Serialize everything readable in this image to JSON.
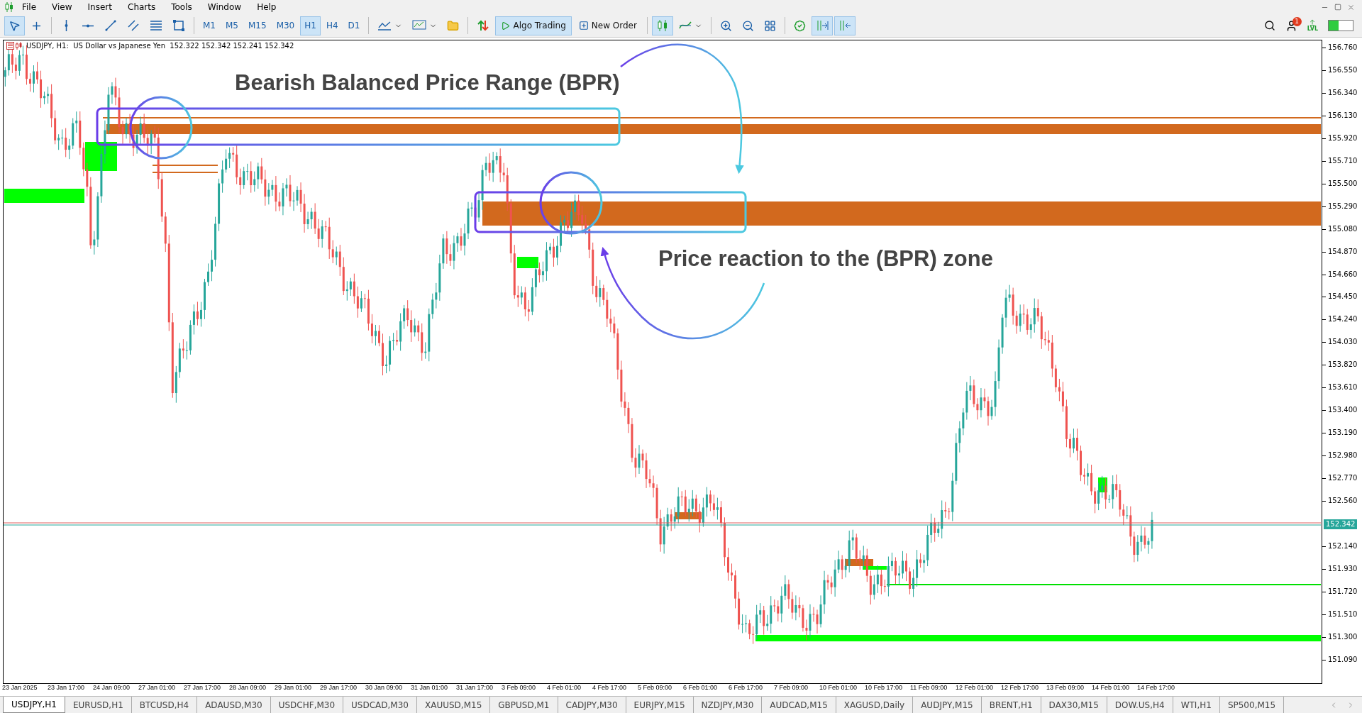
{
  "menu": [
    "File",
    "View",
    "Insert",
    "Charts",
    "Tools",
    "Window",
    "Help"
  ],
  "toolbar": {
    "tools": [
      {
        "kind": "cursor",
        "selected": true
      },
      {
        "kind": "crosshair",
        "selected": false
      },
      {
        "kind": "vline",
        "selected": false
      },
      {
        "kind": "hline",
        "selected": false
      },
      {
        "kind": "trend",
        "selected": false
      },
      {
        "kind": "channel",
        "selected": false
      },
      {
        "kind": "fibo",
        "selected": false
      },
      {
        "kind": "shapes",
        "selected": false
      }
    ],
    "timeframes": [
      {
        "label": "M1",
        "selected": false
      },
      {
        "label": "M5",
        "selected": false
      },
      {
        "label": "M15",
        "selected": false
      },
      {
        "label": "M30",
        "selected": false
      },
      {
        "label": "H1",
        "selected": true
      },
      {
        "label": "H4",
        "selected": false
      },
      {
        "label": "D1",
        "selected": false
      }
    ],
    "algo_trading": {
      "label": "Algo Trading",
      "selected": true
    },
    "new_order": {
      "label": "New Order"
    },
    "chart_tools": [
      {
        "kind": "candles",
        "selected": true
      },
      {
        "kind": "indicators",
        "selected": false
      },
      {
        "kind": "zoom_in",
        "selected": false
      },
      {
        "kind": "zoom_out",
        "selected": false
      },
      {
        "kind": "grid",
        "selected": false
      },
      {
        "kind": "verified",
        "selected": false
      },
      {
        "kind": "shift_end",
        "selected": true
      },
      {
        "kind": "autoscroll",
        "selected": true
      }
    ],
    "notifications_badge": "1",
    "level_label": "LVL"
  },
  "chart": {
    "info": "USDJPY, H1:  US Dollar vs Japanese Yen  152.322 152.342 152.241 152.342",
    "annotations": [
      "Bearish Balanced Price Range (BPR)",
      "Price reaction to the (BPR) zone"
    ],
    "price_labels": [
      "156.760",
      "156.550",
      "156.340",
      "156.130",
      "155.920",
      "155.710",
      "155.500",
      "155.290",
      "155.080",
      "154.870",
      "154.660",
      "154.450",
      "154.240",
      "154.030",
      "153.820",
      "153.610",
      "153.400",
      "153.190",
      "152.980",
      "152.770",
      "152.560",
      "152.140",
      "151.930",
      "151.720",
      "151.510",
      "151.300",
      "151.090"
    ],
    "current_price": "152.342",
    "time_labels": [
      "23 Jan 2025",
      "23 Jan 17:00",
      "24 Jan 09:00",
      "27 Jan 01:00",
      "27 Jan 17:00",
      "28 Jan 09:00",
      "29 Jan 01:00",
      "29 Jan 17:00",
      "30 Jan 09:00",
      "31 Jan 01:00",
      "31 Jan 17:00",
      "3 Feb 09:00",
      "4 Feb 01:00",
      "4 Feb 17:00",
      "5 Feb 09:00",
      "6 Feb 01:00",
      "6 Feb 17:00",
      "7 Feb 09:00",
      "10 Feb 01:00",
      "10 Feb 17:00",
      "11 Feb 09:00",
      "12 Feb 01:00",
      "12 Feb 17:00",
      "13 Feb 09:00",
      "14 Feb 01:00",
      "14 Feb 17:00"
    ]
  },
  "tabs": [
    {
      "label": "USDJPY,H1",
      "selected": true
    },
    {
      "label": "EURUSD,H1",
      "selected": false
    },
    {
      "label": "BTCUSD,H4",
      "selected": false
    },
    {
      "label": "ADAUSD,M30",
      "selected": false
    },
    {
      "label": "USDCHF,M30",
      "selected": false
    },
    {
      "label": "USDCAD,M30",
      "selected": false
    },
    {
      "label": "XAUUSD,M15",
      "selected": false
    },
    {
      "label": "GBPUSD,M1",
      "selected": false
    },
    {
      "label": "CADJPY,M30",
      "selected": false
    },
    {
      "label": "EURJPY,M15",
      "selected": false
    },
    {
      "label": "NZDJPY,M30",
      "selected": false
    },
    {
      "label": "AUDCAD,M15",
      "selected": false
    },
    {
      "label": "XAGUSD,Daily",
      "selected": false
    },
    {
      "label": "AUDJPY,M15",
      "selected": false
    },
    {
      "label": "BRENT,H1",
      "selected": false
    },
    {
      "label": "DAX30,M15",
      "selected": false
    },
    {
      "label": "DOW.US,H4",
      "selected": false
    },
    {
      "label": "WTI,H1",
      "selected": false
    },
    {
      "label": "SP500,M15",
      "selected": false
    }
  ]
}
